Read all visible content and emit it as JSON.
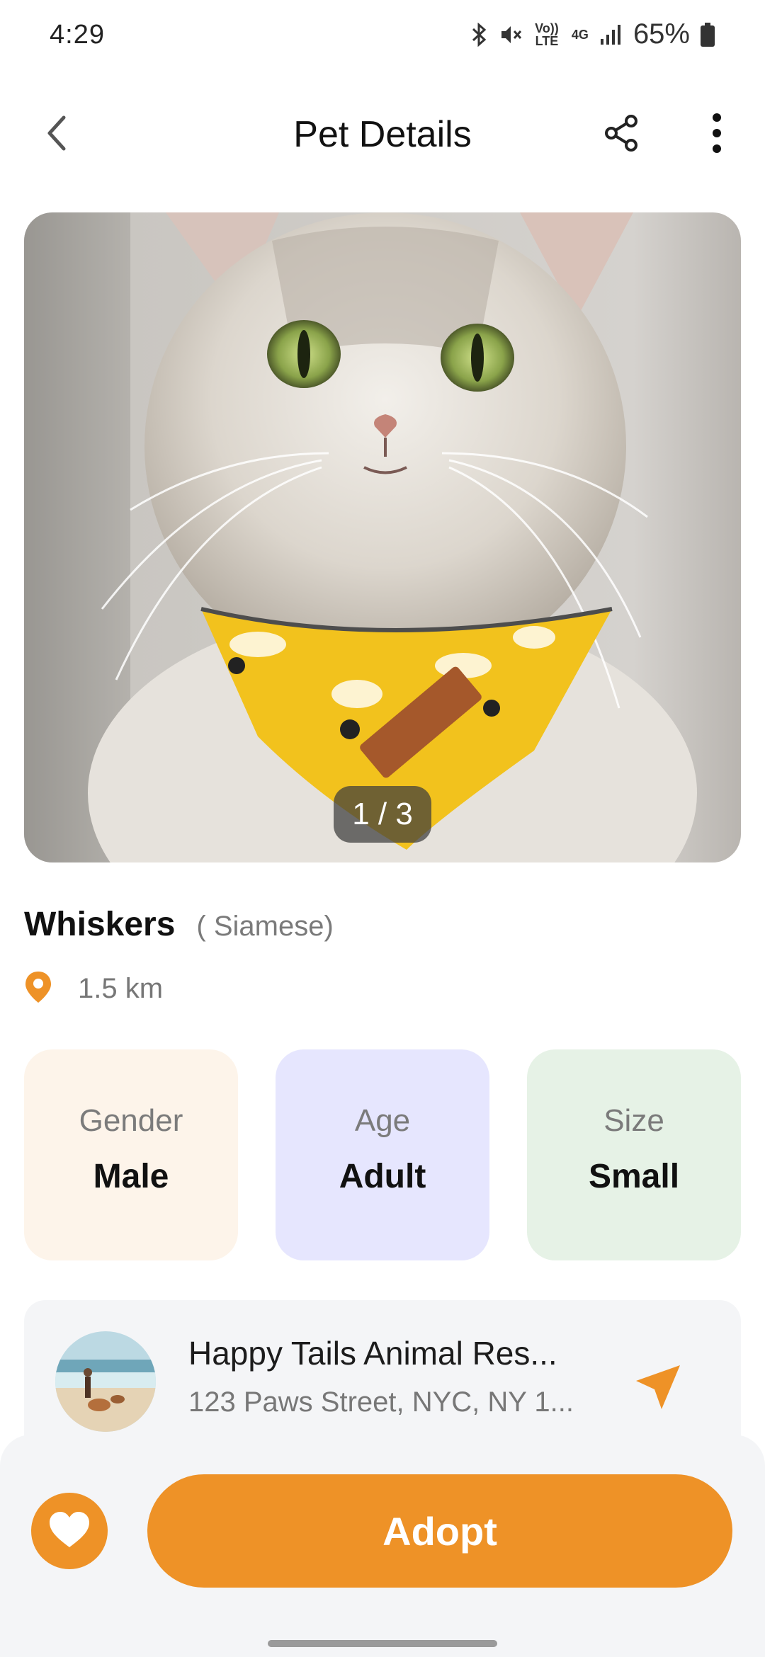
{
  "status_bar": {
    "time": "4:29",
    "volte_label": "Vo)) LTE",
    "network_label": "4G",
    "battery": "65%"
  },
  "header": {
    "title": "Pet Details",
    "icons": [
      "back-chevron-icon",
      "share-icon",
      "more-vertical-icon"
    ]
  },
  "photo": {
    "subject": "cat with yellow bandana",
    "current_index": "1 / 3"
  },
  "pet": {
    "name": "Whiskers",
    "breed": "( Siamese)",
    "distance": "1.5 km"
  },
  "attributes": [
    {
      "label": "Gender",
      "value": "Male",
      "color": "#fdf4ea"
    },
    {
      "label": "Age",
      "value": "Adult",
      "color": "#e6e6fe"
    },
    {
      "label": "Size",
      "value": "Small",
      "color": "#e6f2e6"
    }
  ],
  "shelter": {
    "name": "Happy Tails Animal Res...",
    "address": "123 Paws Street, NYC, NY 1...",
    "directions_icon": "navigation-arrow-icon"
  },
  "actions": {
    "favorite_icon": "heart-icon",
    "adopt_label": "Adopt"
  },
  "colors": {
    "accent": "#ee9227",
    "text_primary": "#111111",
    "text_secondary": "#7a7a7a"
  }
}
